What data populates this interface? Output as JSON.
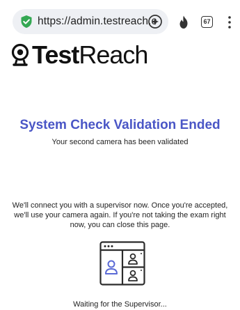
{
  "browser": {
    "url": "https://admin.testreach.c",
    "tab_count": "67",
    "icons": [
      "shield-check-icon",
      "page-action-icon",
      "flame-icon",
      "tab-switcher-icon",
      "more-vert-icon"
    ]
  },
  "logo": {
    "bold_part": "Test",
    "regular_part": "Reach"
  },
  "main": {
    "title": "System Check Validation Ended",
    "subtitle": "Your second camera has been validated",
    "info": "We'll connect you with a supervisor now. Once you're accepted, we'll use your camera again. If you're not taking the exam right now, you can close this page.",
    "waiting": "Waiting for the Supervisor..."
  },
  "colors": {
    "accent": "#4a56c6",
    "shield": "#34a853",
    "illustration_person": "#5a6ad6"
  }
}
